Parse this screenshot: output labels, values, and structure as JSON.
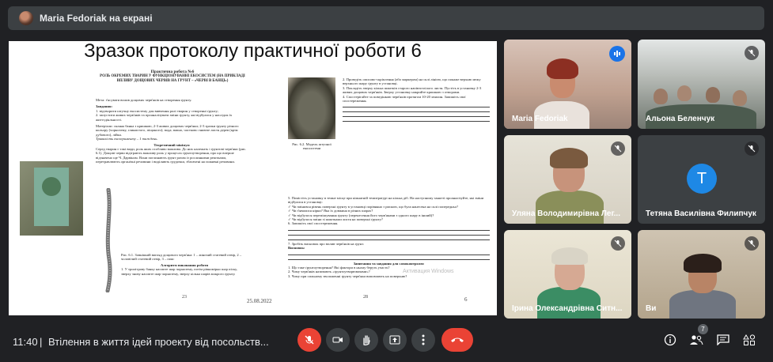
{
  "presenter": {
    "label": "Maria Fedoriak на екрані"
  },
  "slide": {
    "title": "Зразок протоколу практичної роботи 6",
    "left_page": {
      "heading": "Практична робота №6",
      "subheading": "РОЛЬ ОКРЕМИХ ТВАРИН У ФУНКЦІОНУВАННІ ЕКОСИСТЕМ (НА ПРИКЛАДІ ВПЛИВУ ДОЩОВИХ ЧЕРВІВ НА ГРУНТ – «ЧЕРВІ В БАНЦІ»)",
      "goal": "Мета: з'ясувати вплив дощових черв'яків на створення ґрунту.",
      "tasks_title": "Завдання:",
      "task1": "1. відтворити штучну екосистему для вивчення ролі тварин у створенні ґрунту;",
      "task2": "2. запустити живих черв'яків та проаналізувати зміни ґрунту, які відбулися у наслідок їх життєдіяльності.",
      "materials": "Матеріали: скляна банка з кришкою, 2-3 живих дощових черв'яки; 2-3 зразки ґрунту різного кольору (чорнозему, глинистого, піщаного); вода; вапно, частково гниюче листя дерев (крім дубового), лійка.",
      "duration": "Тривалість експерименту – 1 тиждень.",
      "theory_title": "Теоретичний мінімум",
      "theory_text": "Серед тварин є такі види, роль яких особливо важлива. До них належать і ґрунтові черв'яки (рис. 6.1). Дощові черви відіграють важливу роль у процесах ґрунтоутворення, про що вперше відзначено ще Ч. Дарвіном. Вони поглинають ґрунт разом із рослинними рештками, перетравлюють органічні речовини і виділяють грудочки, збагачені на поживні речовини.",
      "fig_caption": "Рис. 6.1. Зовнішній вигляд дощового черв'яка: 1 – жіночий статевий отвір, 2 – чоловічий статевий отвір, 3 – пояс",
      "algorithm_title": "Алгоритм виконання роботи",
      "algorithm_text": "1. У трилітрову банку насипте шар чорнозему, потім рівномірно шар піску, зверху знову насипте шар чорнозему, зверху кілька шарів мокрого ґрунту.",
      "page_no": "23",
      "date": "25.08.2022"
    },
    "right_page": {
      "step2": "2. Проведіть описово-скріплення (або маркером) на склі лінією, що покаже верхню межу верхнього шару ґрунту в установці.",
      "step3": "3. Покладіть зверху кілька шматків старого напівзотлілого листя. Пустіть в установку 2-3 живих дощових черв'яків. Зверху установку накрийте кришкою з отворами.",
      "step4": "4. Спостерігайте за поведінкою черв'яків протягом 10-20 хвилин. Запишіть свої спостереження.",
      "fig_caption": "Рис. 6.2. Модель штучної екосистеми",
      "step5": "5. Помістіть установку в темне місце при кімнатній температурі на кілька діб. На наступному занятті проаналізуйте, які зміни відбулися в установці:",
      "check1": "Чи змінився рівень поверхні ґрунту в установці порівняно з рискою, що була нанесена на склі попередньо?",
      "check2": "Чи з'явилися нірки? Яка їх довжина в різних шарах?",
      "check3": "Чи відбулося перемішування ґрунту (перенесення його черв'яками з одного шару в інший)?",
      "check4": "Чи відбулося зміни зі шматками листя на поверхні ґрунту?",
      "step6": "6. Запишіть свої спостереження.",
      "step7": "7. Зробіть висновок про вплив черв'яків на ґрунт.",
      "conclusion": "Висновок:",
      "selfcheck_title": "Запитання та завдання для самоконтролю:",
      "q1": "1. Що таке ґрунтоутворення? Які фактори в ньому беруть участь?",
      "q2": "2. Чому черв'яків називають «ґрунтоутворювачами»?",
      "q3": "3. Чому при сильному зволоженні ґрунту черв'яки виповзають на поверхню?",
      "page_left_no": "28",
      "page_right_no": "6",
      "watermark": "Активация Windows"
    }
  },
  "participants": [
    {
      "name": "Maria Fedoriak",
      "speaking": true
    },
    {
      "name": "Альона Беленчук",
      "muted": true
    },
    {
      "name": "Уляна Володимирівна Лег...",
      "muted": true
    },
    {
      "name": "Тетяна Василівна Филипчук",
      "muted": true,
      "initial": "T"
    },
    {
      "name": "Ірина Олександрівна Ситн...",
      "muted": true
    },
    {
      "name": "Ви",
      "muted": true
    }
  ],
  "bottom_bar": {
    "time": "11:40",
    "separator": "|",
    "meeting_name": "Втілення в життя ідей проекту від посольств...",
    "people_count": "7"
  },
  "colors": {
    "end_call": "#ea4335",
    "speaking": "#1a73e8",
    "tile_bg": "#3c4043"
  }
}
